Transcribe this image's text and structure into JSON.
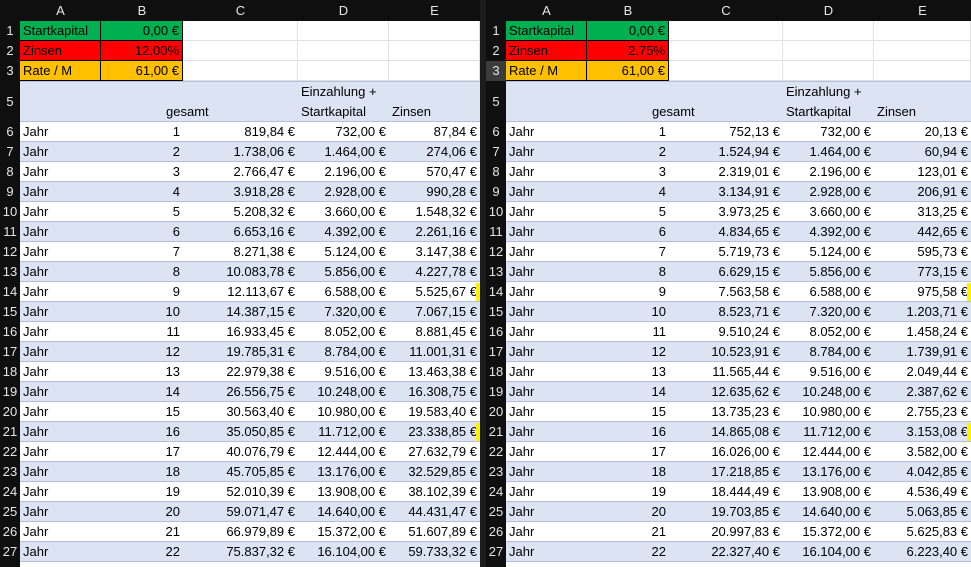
{
  "colors": {
    "green": "#00b050",
    "red": "#ff0000",
    "orange": "#ffc000",
    "band": "#dce3f2",
    "white": "#ffffff",
    "header_bg": "#0f0f0f",
    "marker": "#fff200"
  },
  "columns": [
    "A",
    "B",
    "C",
    "D",
    "E"
  ],
  "left": {
    "params": [
      {
        "row": "1",
        "label": "Startkapital",
        "value": "0,00 €",
        "color": "green"
      },
      {
        "row": "2",
        "label": "Zinsen",
        "value": "12,00%",
        "color": "red"
      },
      {
        "row": "3",
        "label": "Rate / M",
        "value": "61,00 €",
        "color": "orange"
      }
    ],
    "header_row": "5",
    "headers": {
      "gesamt": "gesamt",
      "einzahlung_line1": "Einzahlung +",
      "einzahlung_line2": "Startkapital",
      "zinsen": "Zinsen"
    },
    "rows": [
      {
        "r": "6",
        "a": "Jahr",
        "b": "1",
        "c": "819,84 €",
        "d": "732,00 €",
        "e": "87,84 €"
      },
      {
        "r": "7",
        "a": "Jahr",
        "b": "2",
        "c": "1.738,06 €",
        "d": "1.464,00 €",
        "e": "274,06 €"
      },
      {
        "r": "8",
        "a": "Jahr",
        "b": "3",
        "c": "2.766,47 €",
        "d": "2.196,00 €",
        "e": "570,47 €"
      },
      {
        "r": "9",
        "a": "Jahr",
        "b": "4",
        "c": "3.918,28 €",
        "d": "2.928,00 €",
        "e": "990,28 €"
      },
      {
        "r": "10",
        "a": "Jahr",
        "b": "5",
        "c": "5.208,32 €",
        "d": "3.660,00 €",
        "e": "1.548,32 €"
      },
      {
        "r": "11",
        "a": "Jahr",
        "b": "6",
        "c": "6.653,16 €",
        "d": "4.392,00 €",
        "e": "2.261,16 €"
      },
      {
        "r": "12",
        "a": "Jahr",
        "b": "7",
        "c": "8.271,38 €",
        "d": "5.124,00 €",
        "e": "3.147,38 €"
      },
      {
        "r": "13",
        "a": "Jahr",
        "b": "8",
        "c": "10.083,78 €",
        "d": "5.856,00 €",
        "e": "4.227,78 €"
      },
      {
        "r": "14",
        "a": "Jahr",
        "b": "9",
        "c": "12.113,67 €",
        "d": "6.588,00 €",
        "e": "5.525,67 €"
      },
      {
        "r": "15",
        "a": "Jahr",
        "b": "10",
        "c": "14.387,15 €",
        "d": "7.320,00 €",
        "e": "7.067,15 €"
      },
      {
        "r": "16",
        "a": "Jahr",
        "b": "11",
        "c": "16.933,45 €",
        "d": "8.052,00 €",
        "e": "8.881,45 €"
      },
      {
        "r": "17",
        "a": "Jahr",
        "b": "12",
        "c": "19.785,31 €",
        "d": "8.784,00 €",
        "e": "11.001,31 €"
      },
      {
        "r": "18",
        "a": "Jahr",
        "b": "13",
        "c": "22.979,38 €",
        "d": "9.516,00 €",
        "e": "13.463,38 €"
      },
      {
        "r": "19",
        "a": "Jahr",
        "b": "14",
        "c": "26.556,75 €",
        "d": "10.248,00 €",
        "e": "16.308,75 €"
      },
      {
        "r": "20",
        "a": "Jahr",
        "b": "15",
        "c": "30.563,40 €",
        "d": "10.980,00 €",
        "e": "19.583,40 €"
      },
      {
        "r": "21",
        "a": "Jahr",
        "b": "16",
        "c": "35.050,85 €",
        "d": "11.712,00 €",
        "e": "23.338,85 €"
      },
      {
        "r": "22",
        "a": "Jahr",
        "b": "17",
        "c": "40.076,79 €",
        "d": "12.444,00 €",
        "e": "27.632,79 €"
      },
      {
        "r": "23",
        "a": "Jahr",
        "b": "18",
        "c": "45.705,85 €",
        "d": "13.176,00 €",
        "e": "32.529,85 €"
      },
      {
        "r": "24",
        "a": "Jahr",
        "b": "19",
        "c": "52.010,39 €",
        "d": "13.908,00 €",
        "e": "38.102,39 €"
      },
      {
        "r": "25",
        "a": "Jahr",
        "b": "20",
        "c": "59.071,47 €",
        "d": "14.640,00 €",
        "e": "44.431,47 €"
      },
      {
        "r": "26",
        "a": "Jahr",
        "b": "21",
        "c": "66.979,89 €",
        "d": "15.372,00 €",
        "e": "51.607,89 €"
      },
      {
        "r": "27",
        "a": "Jahr",
        "b": "22",
        "c": "75.837,32 €",
        "d": "16.104,00 €",
        "e": "59.733,32 €"
      }
    ]
  },
  "right": {
    "params": [
      {
        "row": "1",
        "label": "Startkapital",
        "value": "0,00 €",
        "color": "green"
      },
      {
        "row": "2",
        "label": "Zinsen",
        "value": "2,75%",
        "color": "red"
      },
      {
        "row": "3",
        "label": "Rate / M",
        "value": "61,00 €",
        "color": "orange"
      }
    ],
    "header_row": "5",
    "headers": {
      "gesamt": "gesamt",
      "einzahlung_line1": "Einzahlung +",
      "einzahlung_line2": "Startkapital",
      "zinsen": "Zinsen"
    },
    "rows": [
      {
        "r": "6",
        "a": "Jahr",
        "b": "1",
        "c": "752,13 €",
        "d": "732,00 €",
        "e": "20,13 €"
      },
      {
        "r": "7",
        "a": "Jahr",
        "b": "2",
        "c": "1.524,94 €",
        "d": "1.464,00 €",
        "e": "60,94 €"
      },
      {
        "r": "8",
        "a": "Jahr",
        "b": "3",
        "c": "2.319,01 €",
        "d": "2.196,00 €",
        "e": "123,01 €"
      },
      {
        "r": "9",
        "a": "Jahr",
        "b": "4",
        "c": "3.134,91 €",
        "d": "2.928,00 €",
        "e": "206,91 €"
      },
      {
        "r": "10",
        "a": "Jahr",
        "b": "5",
        "c": "3.973,25 €",
        "d": "3.660,00 €",
        "e": "313,25 €"
      },
      {
        "r": "11",
        "a": "Jahr",
        "b": "6",
        "c": "4.834,65 €",
        "d": "4.392,00 €",
        "e": "442,65 €"
      },
      {
        "r": "12",
        "a": "Jahr",
        "b": "7",
        "c": "5.719,73 €",
        "d": "5.124,00 €",
        "e": "595,73 €"
      },
      {
        "r": "13",
        "a": "Jahr",
        "b": "8",
        "c": "6.629,15 €",
        "d": "5.856,00 €",
        "e": "773,15 €"
      },
      {
        "r": "14",
        "a": "Jahr",
        "b": "9",
        "c": "7.563,58 €",
        "d": "6.588,00 €",
        "e": "975,58 €"
      },
      {
        "r": "15",
        "a": "Jahr",
        "b": "10",
        "c": "8.523,71 €",
        "d": "7.320,00 €",
        "e": "1.203,71 €"
      },
      {
        "r": "16",
        "a": "Jahr",
        "b": "11",
        "c": "9.510,24 €",
        "d": "8.052,00 €",
        "e": "1.458,24 €"
      },
      {
        "r": "17",
        "a": "Jahr",
        "b": "12",
        "c": "10.523,91 €",
        "d": "8.784,00 €",
        "e": "1.739,91 €"
      },
      {
        "r": "18",
        "a": "Jahr",
        "b": "13",
        "c": "11.565,44 €",
        "d": "9.516,00 €",
        "e": "2.049,44 €"
      },
      {
        "r": "19",
        "a": "Jahr",
        "b": "14",
        "c": "12.635,62 €",
        "d": "10.248,00 €",
        "e": "2.387,62 €"
      },
      {
        "r": "20",
        "a": "Jahr",
        "b": "15",
        "c": "13.735,23 €",
        "d": "10.980,00 €",
        "e": "2.755,23 €"
      },
      {
        "r": "21",
        "a": "Jahr",
        "b": "16",
        "c": "14.865,08 €",
        "d": "11.712,00 €",
        "e": "3.153,08 €"
      },
      {
        "r": "22",
        "a": "Jahr",
        "b": "17",
        "c": "16.026,00 €",
        "d": "12.444,00 €",
        "e": "3.582,00 €"
      },
      {
        "r": "23",
        "a": "Jahr",
        "b": "18",
        "c": "17.218,85 €",
        "d": "13.176,00 €",
        "e": "4.042,85 €"
      },
      {
        "r": "24",
        "a": "Jahr",
        "b": "19",
        "c": "18.444,49 €",
        "d": "13.908,00 €",
        "e": "4.536,49 €"
      },
      {
        "r": "25",
        "a": "Jahr",
        "b": "20",
        "c": "19.703,85 €",
        "d": "14.640,00 €",
        "e": "5.063,85 €"
      },
      {
        "r": "26",
        "a": "Jahr",
        "b": "21",
        "c": "20.997,83 €",
        "d": "15.372,00 €",
        "e": "5.625,83 €"
      },
      {
        "r": "27",
        "a": "Jahr",
        "b": "22",
        "c": "22.327,40 €",
        "d": "16.104,00 €",
        "e": "6.223,40 €"
      }
    ]
  }
}
